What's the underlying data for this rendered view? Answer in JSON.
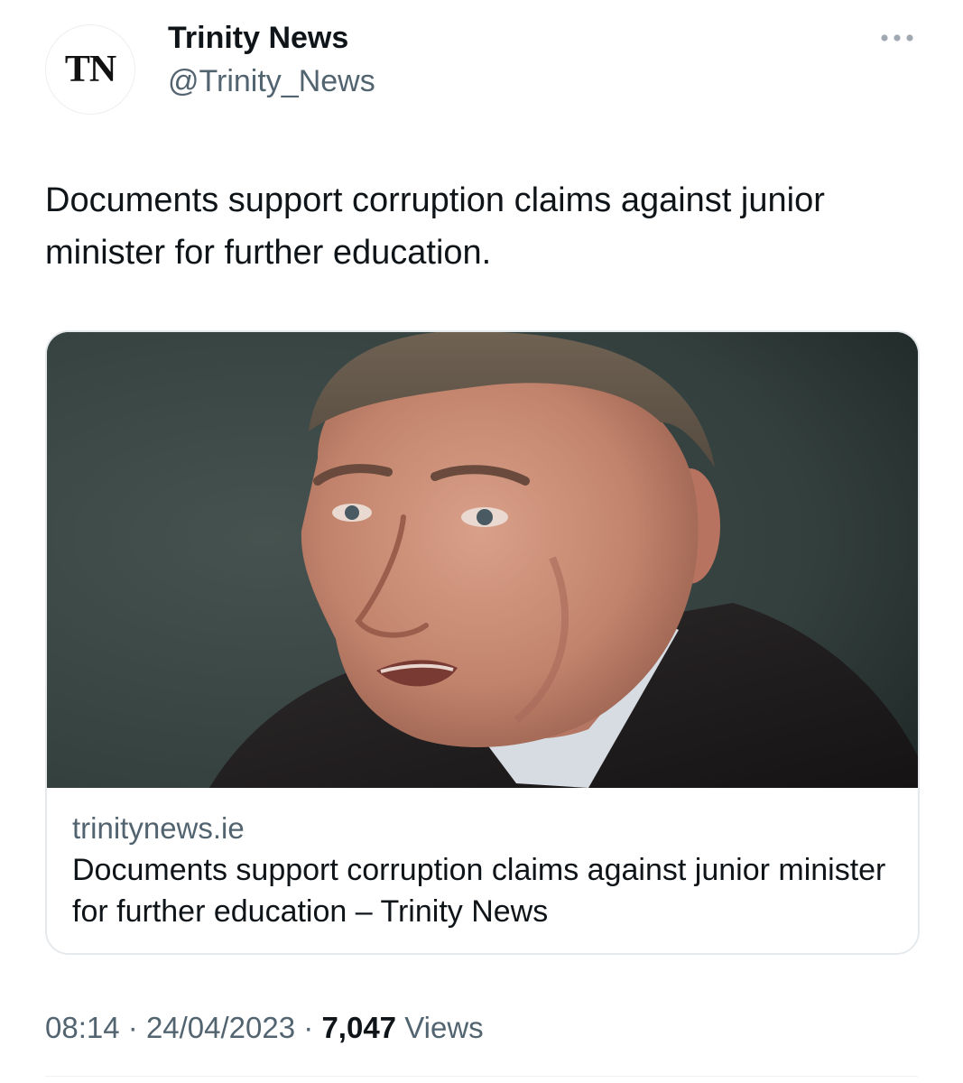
{
  "account": {
    "avatar_text": "TN",
    "display_name": "Trinity News",
    "handle": "@Trinity_News"
  },
  "menu_icon": "more-horizontal-icon",
  "tweet": {
    "text": "Documents support corruption claims against junior minister for further education."
  },
  "card": {
    "domain": "trinitynews.ie",
    "title": "Documents support corruption claims against junior minister for further education – Trinity News"
  },
  "meta": {
    "time": "08:14",
    "separator": "·",
    "date": "24/04/2023",
    "views_count": "7,047",
    "views_label": "Views"
  },
  "colors": {
    "text_primary": "#0f1419",
    "text_secondary": "#536471",
    "border": "#e6e9ec"
  }
}
